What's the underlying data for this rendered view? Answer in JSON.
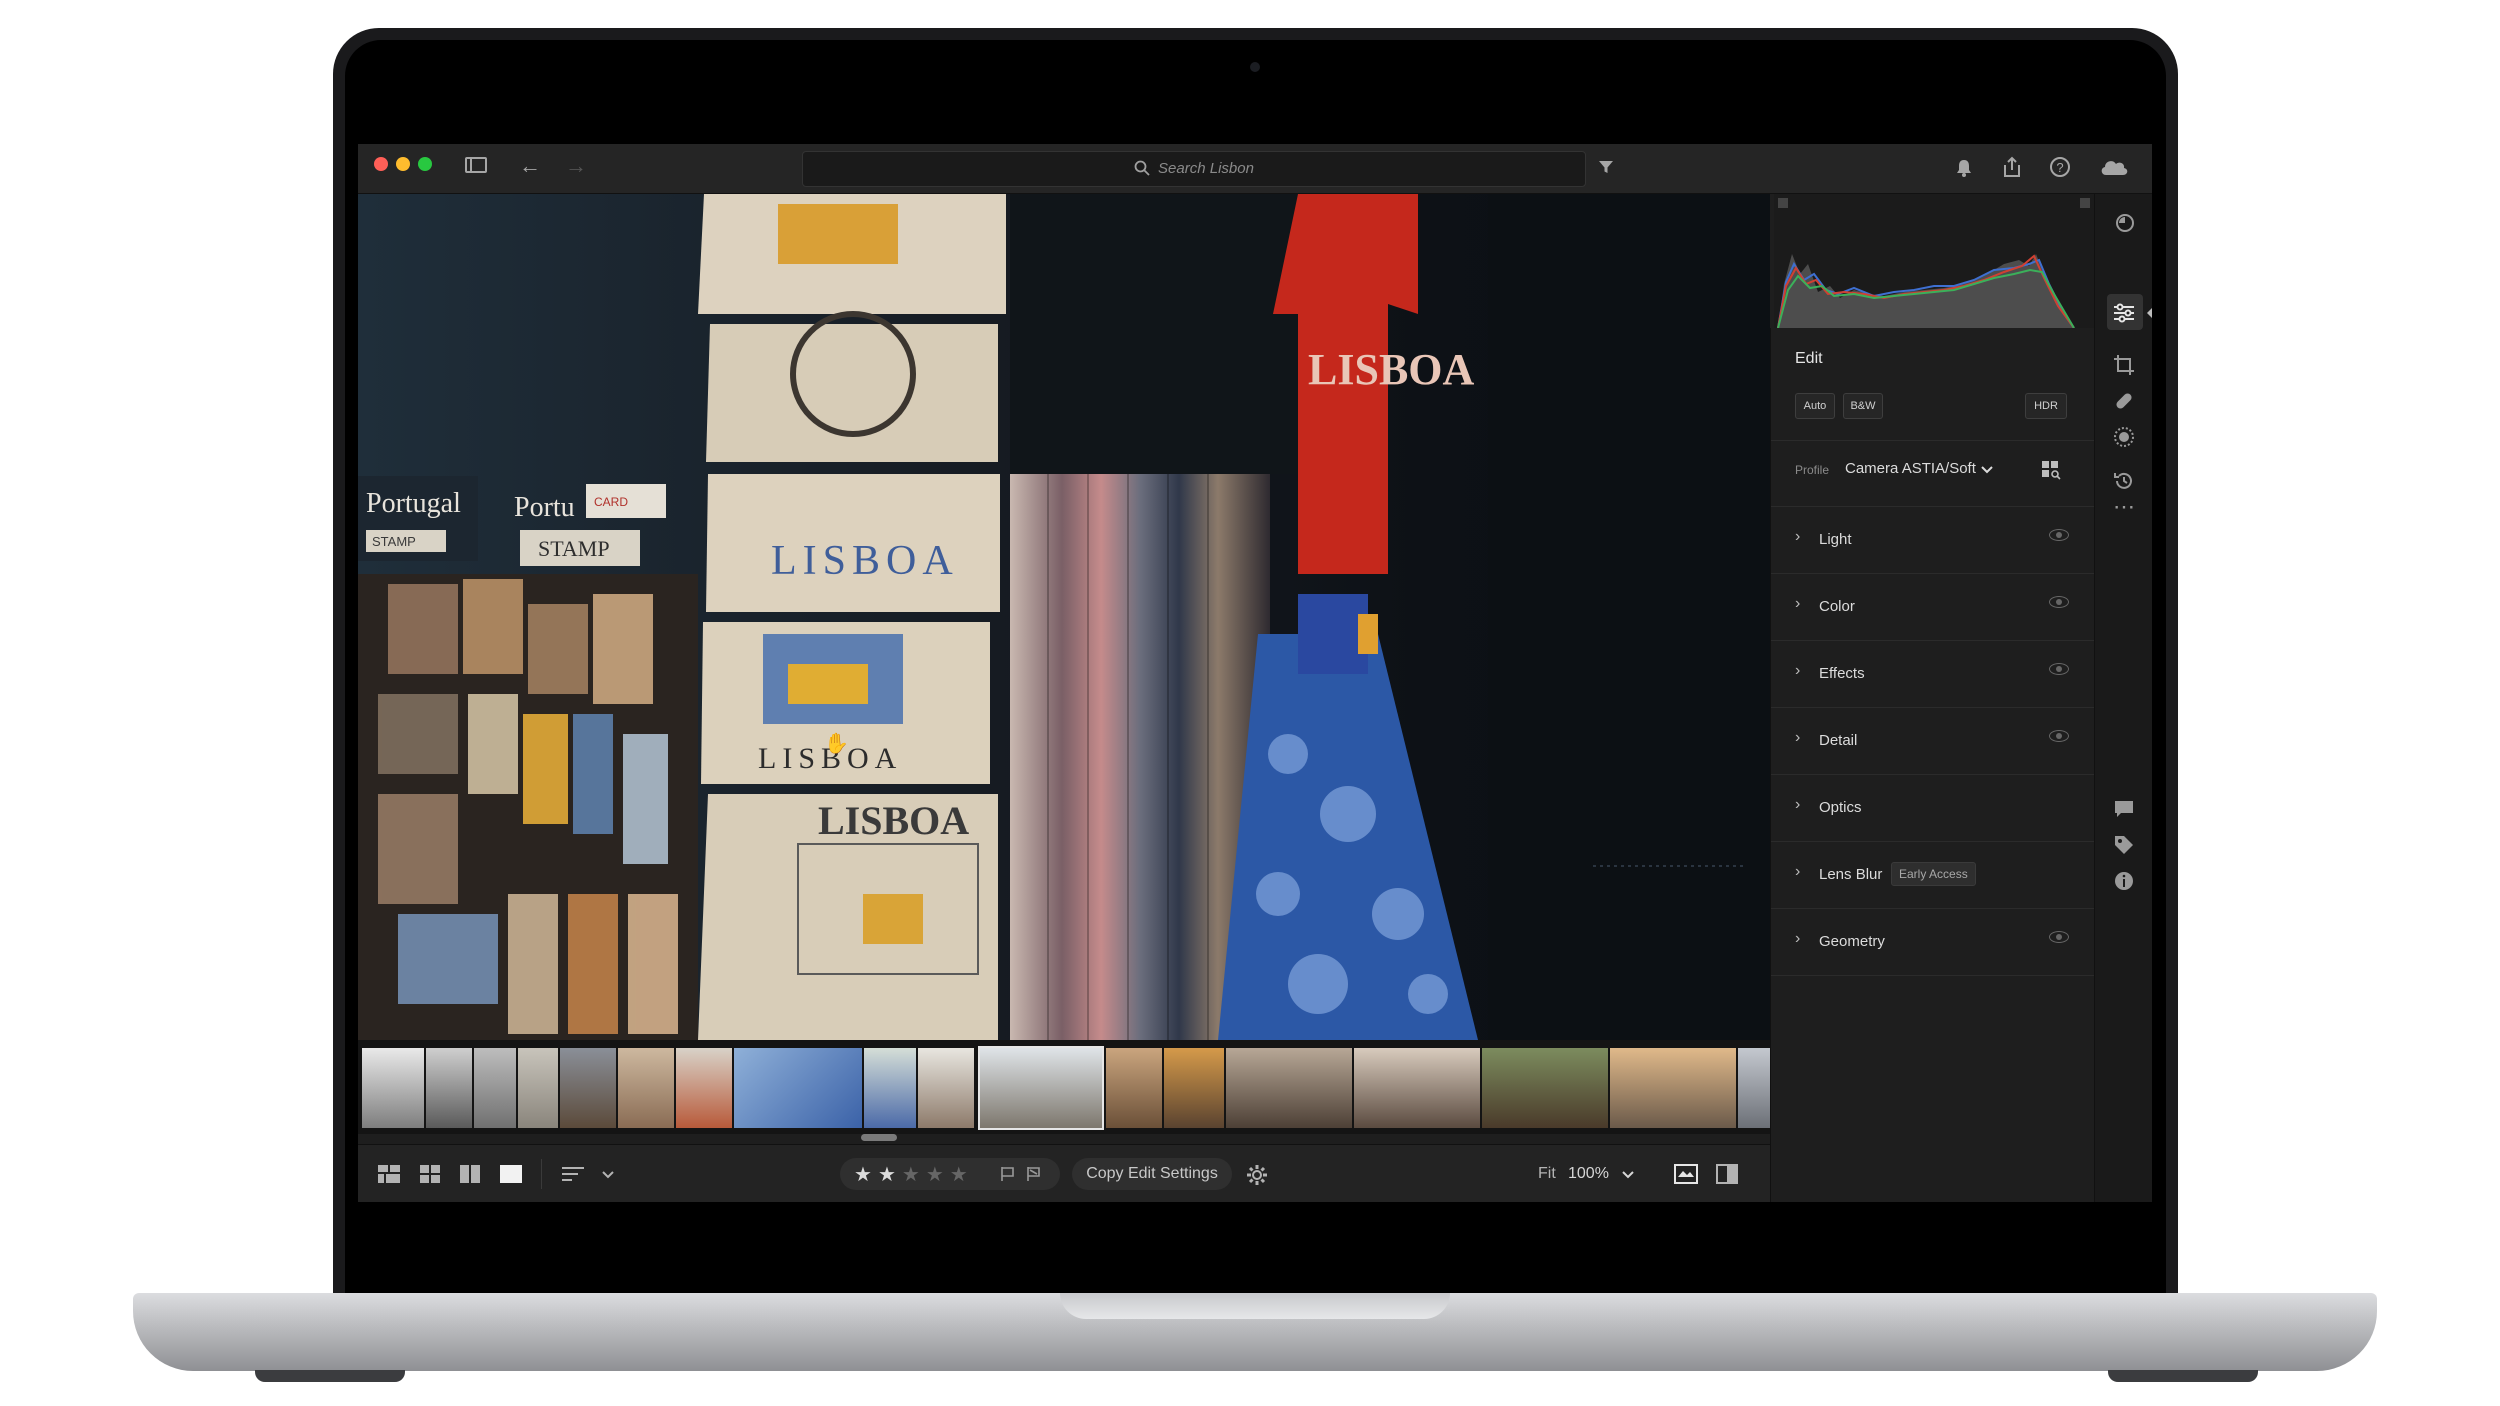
{
  "titlebar": {
    "search_placeholder": "Search Lisbon",
    "icons": [
      "sidebar-icon",
      "back-arrow-icon",
      "forward-arrow-icon",
      "search-icon",
      "filter-icon",
      "bell-icon",
      "share-icon",
      "help-icon",
      "cloud-icon"
    ]
  },
  "photo": {
    "signs": [
      "Portugal",
      "Portu",
      "STAMP",
      "CARD"
    ],
    "bag_texts": [
      "LISBOA",
      "LISBOA",
      "LISBOA"
    ],
    "shirt_text": "LISBOA"
  },
  "panel": {
    "title": "Edit",
    "buttons": {
      "auto": "Auto",
      "bw": "B&W",
      "hdr": "HDR"
    },
    "profile_label": "Profile",
    "profile_value": "Camera ASTIA/Soft",
    "sections": [
      {
        "label": "Light",
        "eye": true
      },
      {
        "label": "Color",
        "eye": true
      },
      {
        "label": "Effects",
        "eye": true
      },
      {
        "label": "Detail",
        "eye": true
      },
      {
        "label": "Optics",
        "eye": false
      },
      {
        "label": "Lens Blur",
        "badge": "Early Access",
        "eye": false
      },
      {
        "label": "Geometry",
        "eye": true
      }
    ]
  },
  "bottombar": {
    "rating": 2,
    "rating_max": 5,
    "copy_edit": "Copy Edit Settings",
    "fit_label": "Fit",
    "zoom": "100%"
  },
  "rail": {
    "icons": [
      "heal-circle-icon",
      "edit-sliders-icon",
      "crop-icon",
      "bandage-icon",
      "mask-circle-icon",
      "history-icon",
      "more-icon",
      "comment-icon",
      "tag-icon",
      "info-icon"
    ]
  }
}
